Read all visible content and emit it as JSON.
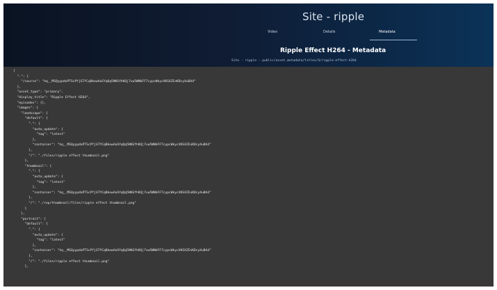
{
  "header": {
    "site_title": "Site - ripple",
    "tabs": [
      {
        "label": "Video",
        "active": false
      },
      {
        "label": "Details",
        "active": false
      },
      {
        "label": "Metadata",
        "active": true
      }
    ],
    "page_title": "Ripple Effect H264 - Metadata",
    "breadcrumb": "Site - ripple - public/asset_metadata/titles/S/ripple-effect-h264"
  },
  "code_lines": [
    "{",
    "  \".\": {",
    "    \"/source\": \"hq__MSQyypdaPTScPfjGTYCqBkowAaSYqQq5NKGfhKQj7vw5WNbFF7cypcWkycXKSXZEnKDcyXuBA4\"",
    "  },",
    "  \"asset_type\": \"primary\",",
    "  \"display_title\": \"Ripple Effect H264\",",
    "  \"episodes\": {},",
    "  \"images\": {",
    "    \"landscape\": {",
    "      \"default\": {",
    "        \".\": {",
    "          \"auto_update\": {",
    "            \"tag\": \"latest\"",
    "          },",
    "          \"container\": \"hq__MSQyypdaPTScPfjGTYCqBkowAaSYqQq5NKGfhKQj7vw5WNbFF7cypcWkycXKSXZEnKDcyXuBA4\"",
    "        },",
    "        \"/\": \"./files/ripple effect thumbnail.png\"",
    "      },",
    "      \"thumbnail\": {",
    "        \".\": {",
    "          \"auto_update\": {",
    "            \"tag\": \"latest\"",
    "          },",
    "          \"container\": \"hq__MSQyypdaPTScPfjGTYCqBkowAaSYqQq5NKGfhKQj7vw5WNbFF7cypcWkycXKSXZEnKDcyXuBA4\"",
    "        },",
    "        \"/\": \"./rep/thumbnail/files/ripple effect thumbnail.png\"",
    "      }",
    "    },",
    "    \"portrait\": {",
    "      \"default\": {",
    "        \".\": {",
    "          \"auto_update\": {",
    "            \"tag\": \"latest\"",
    "          },",
    "          \"container\": \"hq__MSQyypdaPTScPfjGTYCqBkowAaSYqQq5NKGfhKQj7vw5WNbFF7cypcWkycXKSXZEnKDcyXuBA4\"",
    "        },",
    "        \"/\": \"./files/ripple effect thumbnail.png\"",
    "      },"
  ]
}
